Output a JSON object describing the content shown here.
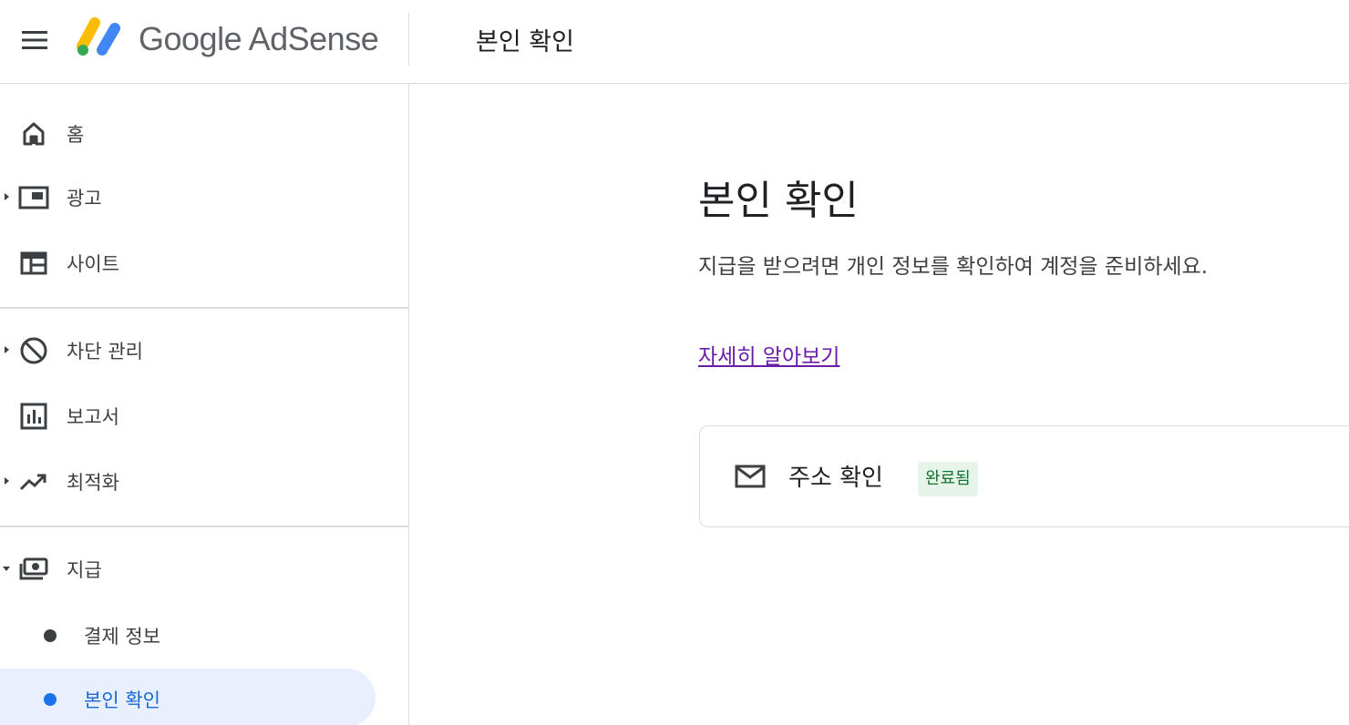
{
  "header": {
    "logo_text": "Google AdSense",
    "page_title": "본인 확인"
  },
  "sidebar": {
    "items": [
      {
        "label": "홈",
        "icon": "home-icon",
        "expandable": false
      },
      {
        "label": "광고",
        "icon": "ads-icon",
        "expandable": true
      },
      {
        "label": "사이트",
        "icon": "sites-icon",
        "expandable": false
      },
      {
        "label": "차단 관리",
        "icon": "block-icon",
        "expandable": true
      },
      {
        "label": "보고서",
        "icon": "reports-icon",
        "expandable": false
      },
      {
        "label": "최적화",
        "icon": "trending-up-icon",
        "expandable": true
      },
      {
        "label": "지급",
        "icon": "payments-icon",
        "expandable": true,
        "expanded": true
      }
    ],
    "sub_items": [
      {
        "label": "결제 정보",
        "active": false
      },
      {
        "label": "본인 확인",
        "active": true
      }
    ]
  },
  "main": {
    "title": "본인 확인",
    "description": "지급을 받으려면 개인 정보를 확인하여 계정을 준비하세요.",
    "learn_more": "자세히 알아보기",
    "card": {
      "icon": "mail-icon",
      "title": "주소 확인",
      "status": "완료됨"
    }
  },
  "colors": {
    "active_bg": "#e8f0fe",
    "active_text": "#1967d2",
    "link": "#681da8",
    "badge_bg": "#e6f4ea",
    "badge_text": "#137333"
  }
}
